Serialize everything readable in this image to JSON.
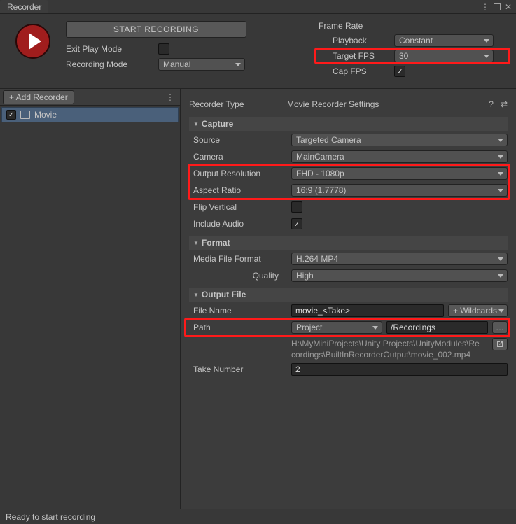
{
  "window": {
    "title": "Recorder"
  },
  "top": {
    "start_label": "START RECORDING",
    "exit_play_label": "Exit Play Mode",
    "exit_play_checked": false,
    "recmode_label": "Recording Mode",
    "recmode_value": "Manual",
    "framerate_label": "Frame Rate",
    "playback_label": "Playback",
    "playback_value": "Constant",
    "targetfps_label": "Target FPS",
    "targetfps_value": "30",
    "capfps_label": "Cap FPS",
    "capfps_checked": true
  },
  "left": {
    "add_label": "+ Add Recorder",
    "items": [
      {
        "label": "Movie",
        "checked": true
      }
    ]
  },
  "right": {
    "type_label": "Recorder Type",
    "type_value": "Movie Recorder Settings",
    "capture": {
      "title": "Capture",
      "source_label": "Source",
      "source_value": "Targeted Camera",
      "camera_label": "Camera",
      "camera_value": "MainCamera",
      "res_label": "Output Resolution",
      "res_value": "FHD - 1080p",
      "aspect_label": "Aspect Ratio",
      "aspect_value": "16:9 (1.7778)",
      "flip_label": "Flip Vertical",
      "flip_checked": false,
      "audio_label": "Include Audio",
      "audio_checked": true
    },
    "format": {
      "title": "Format",
      "media_label": "Media File Format",
      "media_value": "H.264 MP4",
      "quality_label": "Quality",
      "quality_value": "High"
    },
    "output": {
      "title": "Output File",
      "fn_label": "File Name",
      "fn_value": "movie_<Take>",
      "wild_label": "+ Wildcards",
      "path_label": "Path",
      "path_value": "Project",
      "path_sub": "/Recordings",
      "full_path": "H:\\MyMiniProjects\\Unity Projects\\UnityModules\\Recordings\\BuiltInRecorderOutput\\movie_002.mp4",
      "take_label": "Take Number",
      "take_value": "2"
    }
  },
  "status": {
    "text": "Ready to start recording"
  }
}
